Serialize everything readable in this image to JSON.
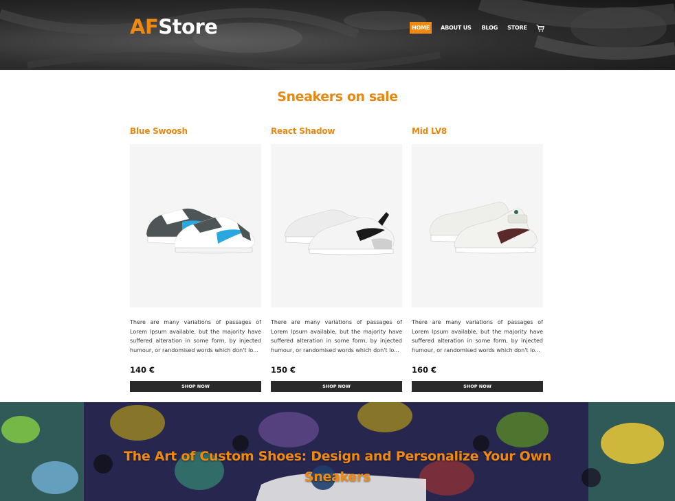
{
  "brand": {
    "part1": "AF",
    "part2": "Store"
  },
  "nav": {
    "items": [
      {
        "label": "HOME",
        "active": true
      },
      {
        "label": "ABOUT US"
      },
      {
        "label": "BLOG"
      },
      {
        "label": "STORE"
      }
    ],
    "cart_icon": "cart-icon"
  },
  "products_section": {
    "title": "Sneakers on sale",
    "products": [
      {
        "name": "Blue Swoosh",
        "description": "There are many variations of passages of Lorem Ipsum available, but the majority have suffered alteration in some form, by injected humour, or randomised words which don't lo...",
        "price": "140 €",
        "button": "SHOP NOW",
        "accent_color": "#29a8e0"
      },
      {
        "name": "React Shadow",
        "description": "There are many variations of passages of Lorem Ipsum available, but the majority have suffered alteration in some form, by injected humour, or randomised words which don't lo...",
        "price": "150 €",
        "button": "SHOP NOW",
        "accent_color": "#1a1a1a"
      },
      {
        "name": "Mid LV8",
        "description": "There are many variations of passages of Lorem Ipsum available, but the majority have suffered alteration in some form, by injected humour, or randomised words which don't lo...",
        "price": "160 €",
        "button": "SHOP NOW",
        "accent_color": "#5a2a2a"
      }
    ]
  },
  "banner": {
    "title": "The Art of Custom Shoes: Design and Personalize Your Own Sneakers"
  },
  "colors": {
    "brand_orange": "#f0890f",
    "dark": "#2a2a2a"
  }
}
